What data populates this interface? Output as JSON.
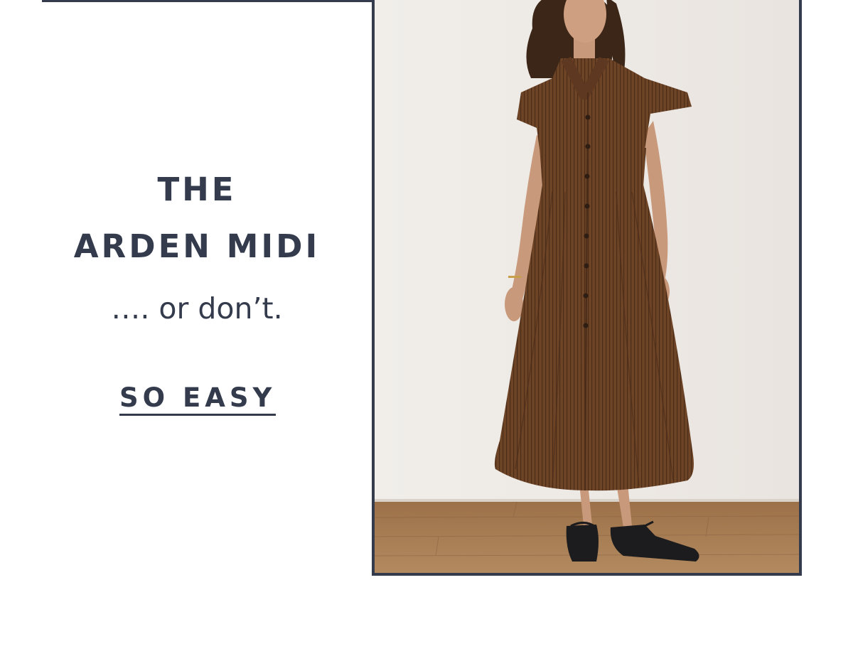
{
  "promo": {
    "headline_line1": "THE",
    "headline_line2": "ARDEN MIDI",
    "tagline": "…. or don’t.",
    "cta_label": "SO EASY"
  },
  "photo": {
    "subject": "model-wearing-brown-pinstripe-shirt-dress",
    "colors": {
      "frame": "#333b4c",
      "wall": "#efebe7",
      "floor": "#a57a52",
      "dress": "#6e4427",
      "shoes": "#1c1c1e"
    }
  },
  "theme": {
    "text_color": "#333b4c",
    "background": "#ffffff"
  }
}
